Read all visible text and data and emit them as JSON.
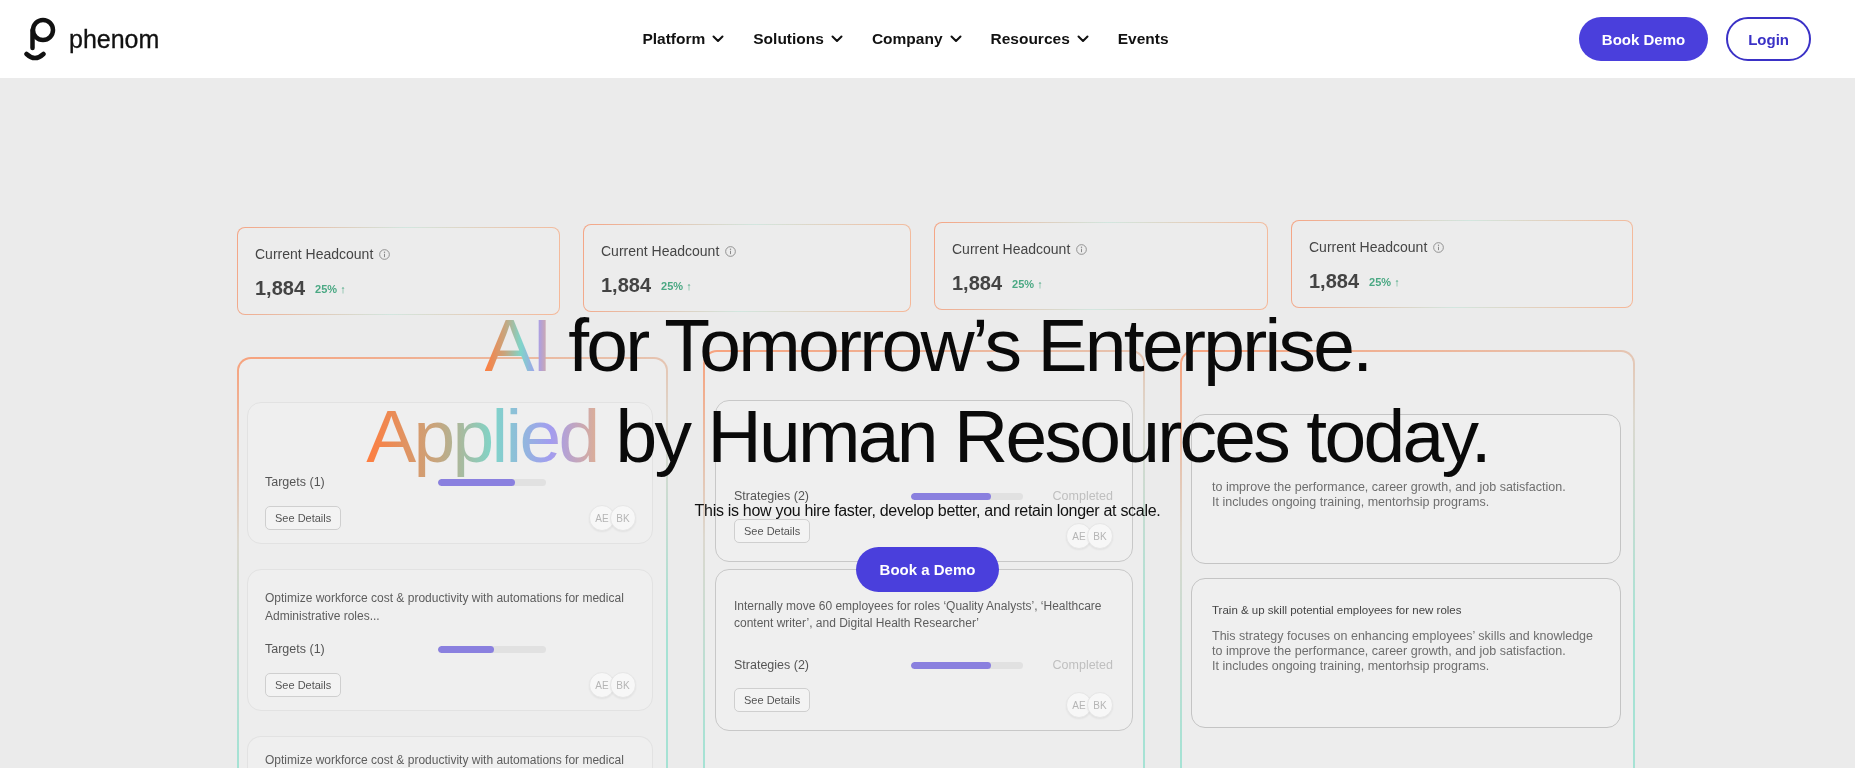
{
  "header": {
    "logo": {
      "text": "phenom"
    },
    "nav": [
      {
        "label": "Platform",
        "has_menu": true
      },
      {
        "label": "Solutions",
        "has_menu": true
      },
      {
        "label": "Company",
        "has_menu": true
      },
      {
        "label": "Resources",
        "has_menu": true
      },
      {
        "label": "Events",
        "has_menu": false
      }
    ],
    "buttons": [
      {
        "label": "Book Demo",
        "kind": "primary"
      },
      {
        "label": "Login",
        "kind": "outline"
      }
    ]
  },
  "hero": {
    "headline": [
      {
        "accent": "AI",
        "text": "for Tomorrow’s Enterprise."
      },
      {
        "accent": "Applied",
        "text": "by Human Resources today."
      }
    ],
    "subtitle": "This is how you hire faster, develop better, and retain longer at scale.",
    "cta": "Book a Demo"
  },
  "dashboard": {
    "metrics": [
      {
        "label": "Current Headcount",
        "value": "1,884",
        "change": "25% ↑"
      },
      {
        "label": "Current Headcount",
        "value": "1,884",
        "change": "25% ↑"
      },
      {
        "label": "Current Headcount",
        "value": "1,884",
        "change": "25% ↑"
      },
      {
        "label": "Current Headcount",
        "value": "1,884",
        "change": "25% ↑"
      }
    ],
    "columns": [
      {
        "kind": "targets",
        "cards": [
          {
            "label": "Targets (1)",
            "level": 0.71,
            "button": "See Details",
            "avatars": [
              "AE",
              "BK"
            ]
          },
          {
            "description": "Optimize workforce cost & productivity with automations for medical Administrative roles...",
            "label": "Targets (1)",
            "level": 0.52,
            "button": "See Details",
            "avatars": [
              "AE",
              "BK"
            ]
          },
          {
            "description": "Optimize workforce cost & productivity with automations for medical"
          }
        ]
      },
      {
        "kind": "strategies",
        "cards": [
          {
            "label": "Strategies (2)",
            "level": 0.71,
            "status": "Completed",
            "button": "See Details",
            "avatars": [
              "AE",
              "BK"
            ]
          },
          {
            "description": "Internally move 60 employees for roles ‘Quality Analysts’, ‘Healthcare content writer’, and Digital Health Researcher’",
            "label": "Strategies (2)",
            "level": 0.71,
            "status": "Completed",
            "button": "See Details",
            "avatars": [
              "AE",
              "BK"
            ]
          }
        ]
      },
      {
        "kind": "plans",
        "cards": [
          {
            "lines": [
              "to improve the performance, career growth, and job satisfaction.",
              "It includes ongoing training, mentorhsip programs."
            ]
          },
          {
            "title": "Train & up skill potential employees for new roles",
            "lines": [
              "This strategy focuses on enhancing employees’ skills and knowledge",
              "to improve the performance, career growth, and job satisfaction.",
              "It includes ongoing training, mentorhsip programs."
            ]
          }
        ]
      }
    ]
  }
}
